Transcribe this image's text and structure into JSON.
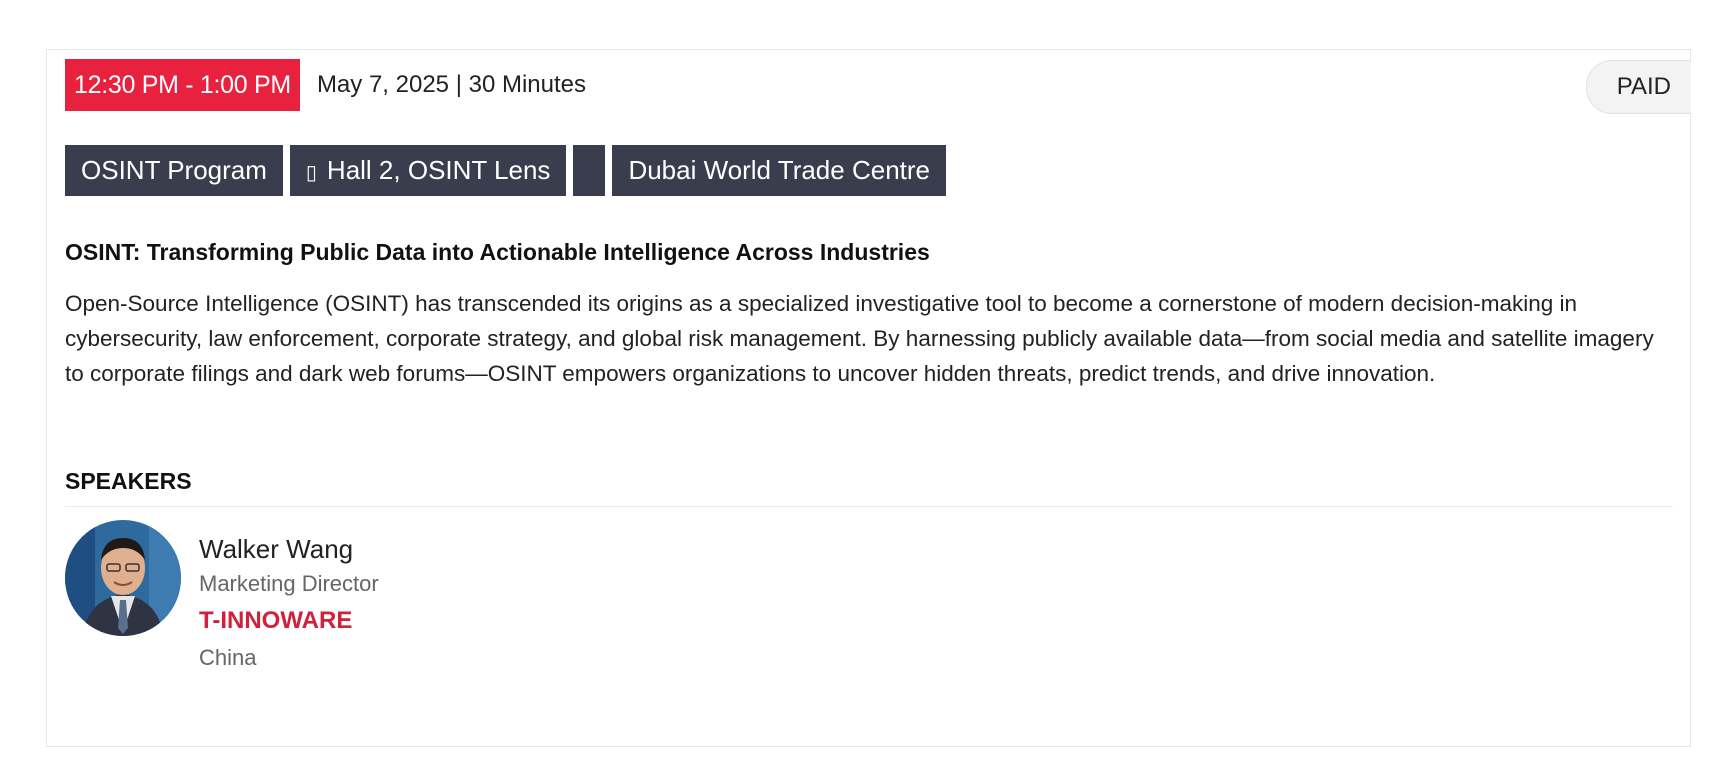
{
  "session": {
    "time": "12:30 PM - 1:00 PM",
    "date_duration": "May 7, 2025 | 30 Minutes",
    "price_badge": "PAID",
    "tags": {
      "program": "OSINT Program",
      "location": "Hall 2, OSINT Lens",
      "location_icon": "▯",
      "venue": "Dubai World Trade Centre"
    },
    "title": "OSINT: Transforming Public Data into Actionable Intelligence Across Industries",
    "description": "Open-Source Intelligence (OSINT) has transcended its origins as a specialized investigative tool to become a cornerstone of modern decision-making in cybersecurity, law enforcement, corporate strategy, and global risk management. By harnessing publicly available data—from social media and satellite imagery to corporate filings and dark web forums—OSINT empowers organizations to uncover hidden threats, predict trends, and drive innovation."
  },
  "speakers": {
    "heading": "SPEAKERS",
    "list": [
      {
        "name": "Walker Wang",
        "role": "Marketing Director",
        "company": "T-INNOWARE",
        "country": "China"
      }
    ]
  },
  "colors": {
    "accent_red": "#e8213f",
    "tag_bg": "#3a3d4d",
    "company_red": "#d1203c"
  }
}
